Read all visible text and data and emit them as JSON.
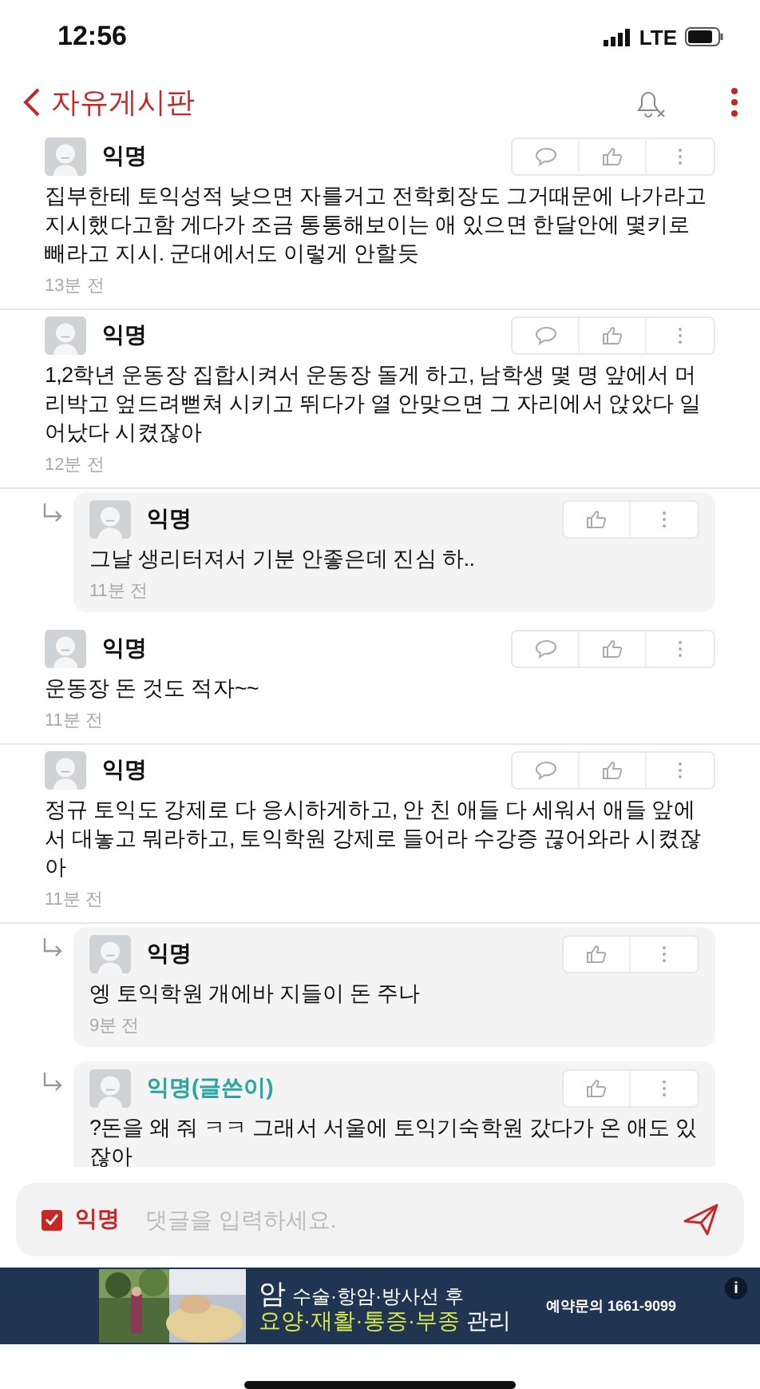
{
  "status_bar": {
    "time": "12:56",
    "network": "LTE"
  },
  "header": {
    "title": "자유게시판"
  },
  "comments": [
    {
      "kind": "comment",
      "author": "익명",
      "is_writer": false,
      "text": "집부한테 토익성적 낮으면 자를거고 전학회장도 그거때문에 나가라고 지시했다고함 게다가 조금 통통해보이는 애 있으면 한달안에 몇키로 빼라고 지시. 군대에서도 이렇게 안할듯",
      "time": "13분 전"
    },
    {
      "kind": "comment",
      "author": "익명",
      "is_writer": false,
      "text": "1,2학년 운동장 집합시켜서 운동장 돌게 하고, 남학생 몇 명 앞에서 머리박고 엎드려뻗쳐 시키고 뛰다가 열 안맞으면 그 자리에서 앉았다 일어났다 시켰잖아",
      "time": "12분 전"
    },
    {
      "kind": "reply",
      "author": "익명",
      "is_writer": false,
      "text": "그날 생리터져서 기분 안좋은데 진심 하..",
      "time": "11분 전"
    },
    {
      "kind": "comment",
      "author": "익명",
      "is_writer": false,
      "text": "운동장 돈 것도 적자~~",
      "time": "11분 전"
    },
    {
      "kind": "comment",
      "author": "익명",
      "is_writer": false,
      "text": "정규 토익도 강제로 다 응시하게하고, 안 친 애들 다 세워서 애들 앞에서 대놓고 뭐라하고, 토익학원 강제로 들어라 수강증 끊어와라 시켰잖아",
      "time": "11분 전"
    },
    {
      "kind": "reply",
      "author": "익명",
      "is_writer": false,
      "text": "엥 토익학원 개에바 지들이 돈 주나",
      "time": "9분 전"
    },
    {
      "kind": "reply",
      "author": "익명(글쓴이)",
      "is_writer": true,
      "text": "?돈을 왜 줘 ㅋㅋ 그래서 서울에 토익기숙학원 갔다가 온 애도 있잖아"
    }
  ],
  "comment_input": {
    "anonymous_label": "익명",
    "anonymous_checked": true,
    "placeholder": "댓글을 입력하세요."
  },
  "ad": {
    "line_1_lead": "암",
    "line_1": "수술·항암·방사선 후",
    "line_2_highlight": "요양·재활·통증·부종",
    "line_2": "관리",
    "phone": "예약문의 1661-9099",
    "info": "i"
  }
}
